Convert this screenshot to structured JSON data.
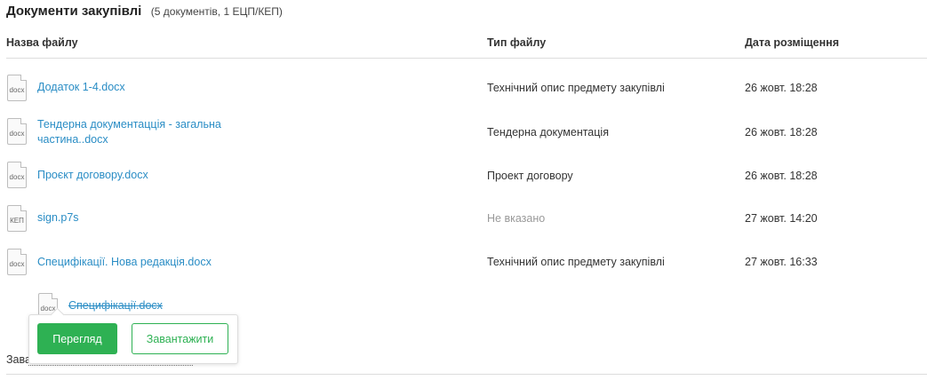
{
  "header": {
    "title": "Документи закупівлі",
    "summary": "(5 документів, 1 ЕЦП/КЕП)"
  },
  "columns": {
    "name": "Назва файлу",
    "type": "Тип файлу",
    "date": "Дата розміщення"
  },
  "files": [
    {
      "icon": "docx",
      "name": "Додаток 1-4.docx",
      "type": "Технічний опис предмету закупівлі",
      "date": "26 жовт. 18:28"
    },
    {
      "icon": "docx",
      "name": "Тендерна документацція - загальна частина..docx",
      "type": "Тендерна документація",
      "date": "26 жовт. 18:28"
    },
    {
      "icon": "docx",
      "name": "Проєкт договору.docx",
      "type": "Проект договору",
      "date": "26 жовт. 18:28"
    },
    {
      "icon": "КЕП",
      "name": "sign.p7s",
      "type": "Не вказано",
      "date": "27 жовт. 14:20"
    },
    {
      "icon": "docx",
      "name": "Специфікації. Нова редакція.docx",
      "type": "Технічний опис предмету закупівлі",
      "date": "27 жовт. 16:33"
    }
  ],
  "old_version": {
    "icon": "docx",
    "name": "Специфікації.docx"
  },
  "popover": {
    "view_label": "Перегляд",
    "download_label": "Завантажити"
  },
  "partial_text": "Завантажити"
}
